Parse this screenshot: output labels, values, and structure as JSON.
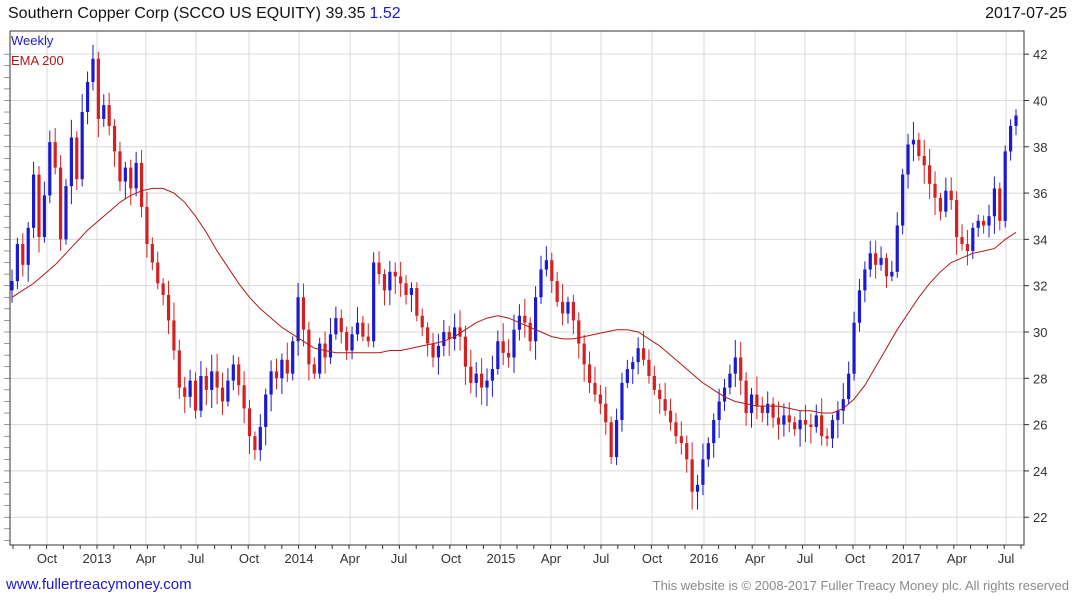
{
  "header": {
    "title": "Southern Copper Corp (SCCO US EQUITY) 39.35",
    "change": "1.52",
    "date": "2017-07-25"
  },
  "footer": {
    "link": "www.fullertreacymoney.com",
    "copyright": "This website is © 2008-2017 Fuller Treacy Money plc. All rights reserved"
  },
  "colors": {
    "up": "#1a1ad0",
    "down": "#d42020",
    "ema": "#b01818",
    "grid": "#d9d9d9",
    "axis": "#333333"
  },
  "chart_data": {
    "type": "candlestick",
    "x_tick_labels": [
      "Oct",
      "2013",
      "Apr",
      "Jul",
      "Oct",
      "2014",
      "Apr",
      "Jul",
      "Oct",
      "2015",
      "Apr",
      "Jul",
      "Oct",
      "2016",
      "Apr",
      "Jul",
      "Oct",
      "2017",
      "Apr",
      "Jul"
    ],
    "y_ticks": [
      22,
      24,
      26,
      28,
      30,
      32,
      34,
      36,
      38,
      40,
      42
    ],
    "ylim": [
      20.8,
      43.0
    ],
    "legend": [
      {
        "label": "Weekly",
        "color": "#1a1ad0"
      },
      {
        "label": "EMA 200",
        "color": "#b01818"
      }
    ],
    "grid": true,
    "weekly_close": [
      32.2,
      33.8,
      32.9,
      34.5,
      36.8,
      34.1,
      35.9,
      38.2,
      37.1,
      34.0,
      36.3,
      38.4,
      36.6,
      39.5,
      40.8,
      41.8,
      39.2,
      39.8,
      38.9,
      37.8,
      36.5,
      37.1,
      36.2,
      37.3,
      35.4,
      33.8,
      33.0,
      32.1,
      31.6,
      30.5,
      29.2,
      27.6,
      27.2,
      27.9,
      26.6,
      28.1,
      27.5,
      28.3,
      27.6,
      27.0,
      27.9,
      28.6,
      27.7,
      26.7,
      25.5,
      24.9,
      25.9,
      27.3,
      28.3,
      28.0,
      28.8,
      28.2,
      29.6,
      31.5,
      30.1,
      28.6,
      28.2,
      29.5,
      28.9,
      29.9,
      30.6,
      30.0,
      29.2,
      29.9,
      30.4,
      29.8,
      29.6,
      33.0,
      32.5,
      31.8,
      32.6,
      32.4,
      32.1,
      31.6,
      31.9,
      30.7,
      30.2,
      29.5,
      28.9,
      29.4,
      30.0,
      29.7,
      30.2,
      29.8,
      28.5,
      27.8,
      28.2,
      27.6,
      27.9,
      28.4,
      29.6,
      29.1,
      28.9,
      30.1,
      30.7,
      30.4,
      29.6,
      31.5,
      32.7,
      33.1,
      32.2,
      31.3,
      30.8,
      31.3,
      30.5,
      29.5,
      28.6,
      27.8,
      27.3,
      26.9,
      26.1,
      24.6,
      26.2,
      27.8,
      28.4,
      28.7,
      29.3,
      28.8,
      28.1,
      27.5,
      27.1,
      26.6,
      26.1,
      25.5,
      25.2,
      24.5,
      23.1,
      23.4,
      24.5,
      25.2,
      26.2,
      27.0,
      27.6,
      28.2,
      28.9,
      27.9,
      26.5,
      27.3,
      26.8,
      26.5,
      26.9,
      26.3,
      26.0,
      26.4,
      26.1,
      25.8,
      26.2,
      26.0,
      25.9,
      26.4,
      25.5,
      25.4,
      26.2,
      26.6,
      27.1,
      28.2,
      30.4,
      31.8,
      32.7,
      33.4,
      32.9,
      33.2,
      32.4,
      32.6,
      34.6,
      36.8,
      38.1,
      38.3,
      37.6,
      37.2,
      36.4,
      35.8,
      35.2,
      36.1,
      35.7,
      34.1,
      33.8,
      33.5,
      34.5,
      34.8,
      34.6,
      35.0,
      36.2,
      34.8,
      37.8,
      38.9,
      39.35
    ],
    "ema_200": [
      31.5,
      31.8,
      32.1,
      32.5,
      32.9,
      33.4,
      33.9,
      34.4,
      34.8,
      35.2,
      35.6,
      35.9,
      36.1,
      36.2,
      36.2,
      36.0,
      35.6,
      35.0,
      34.3,
      33.5,
      32.8,
      32.1,
      31.5,
      31.0,
      30.6,
      30.2,
      29.9,
      29.6,
      29.3,
      29.2,
      29.1,
      29.1,
      29.1,
      29.1,
      29.1,
      29.2,
      29.2,
      29.3,
      29.4,
      29.5,
      29.6,
      29.8,
      30.1,
      30.4,
      30.6,
      30.7,
      30.6,
      30.4,
      30.2,
      30.0,
      29.8,
      29.7,
      29.7,
      29.8,
      29.9,
      30.0,
      30.1,
      30.1,
      30.0,
      29.7,
      29.4,
      29.0,
      28.6,
      28.2,
      27.8,
      27.5,
      27.2,
      27.0,
      26.9,
      26.8,
      26.8,
      26.8,
      26.7,
      26.6,
      26.6,
      26.5,
      26.5,
      26.7,
      27.1,
      27.7,
      28.5,
      29.3,
      30.1,
      30.8,
      31.5,
      32.1,
      32.6,
      33.0,
      33.2,
      33.4,
      33.5,
      33.6,
      34.0,
      34.3
    ]
  }
}
